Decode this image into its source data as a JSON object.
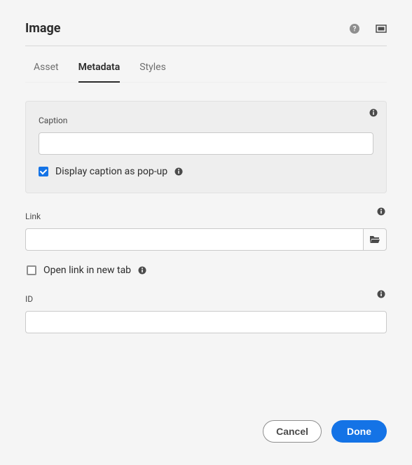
{
  "header": {
    "title": "Image"
  },
  "tabs": {
    "asset": "Asset",
    "metadata": "Metadata",
    "styles": "Styles",
    "active": "metadata"
  },
  "fields": {
    "caption": {
      "label": "Caption",
      "value": ""
    },
    "displayPopup": {
      "label": "Display caption as pop-up",
      "checked": true
    },
    "link": {
      "label": "Link",
      "value": ""
    },
    "openNewTab": {
      "label": "Open link in new tab",
      "checked": false
    },
    "id": {
      "label": "ID",
      "value": ""
    }
  },
  "footer": {
    "cancel": "Cancel",
    "done": "Done"
  }
}
